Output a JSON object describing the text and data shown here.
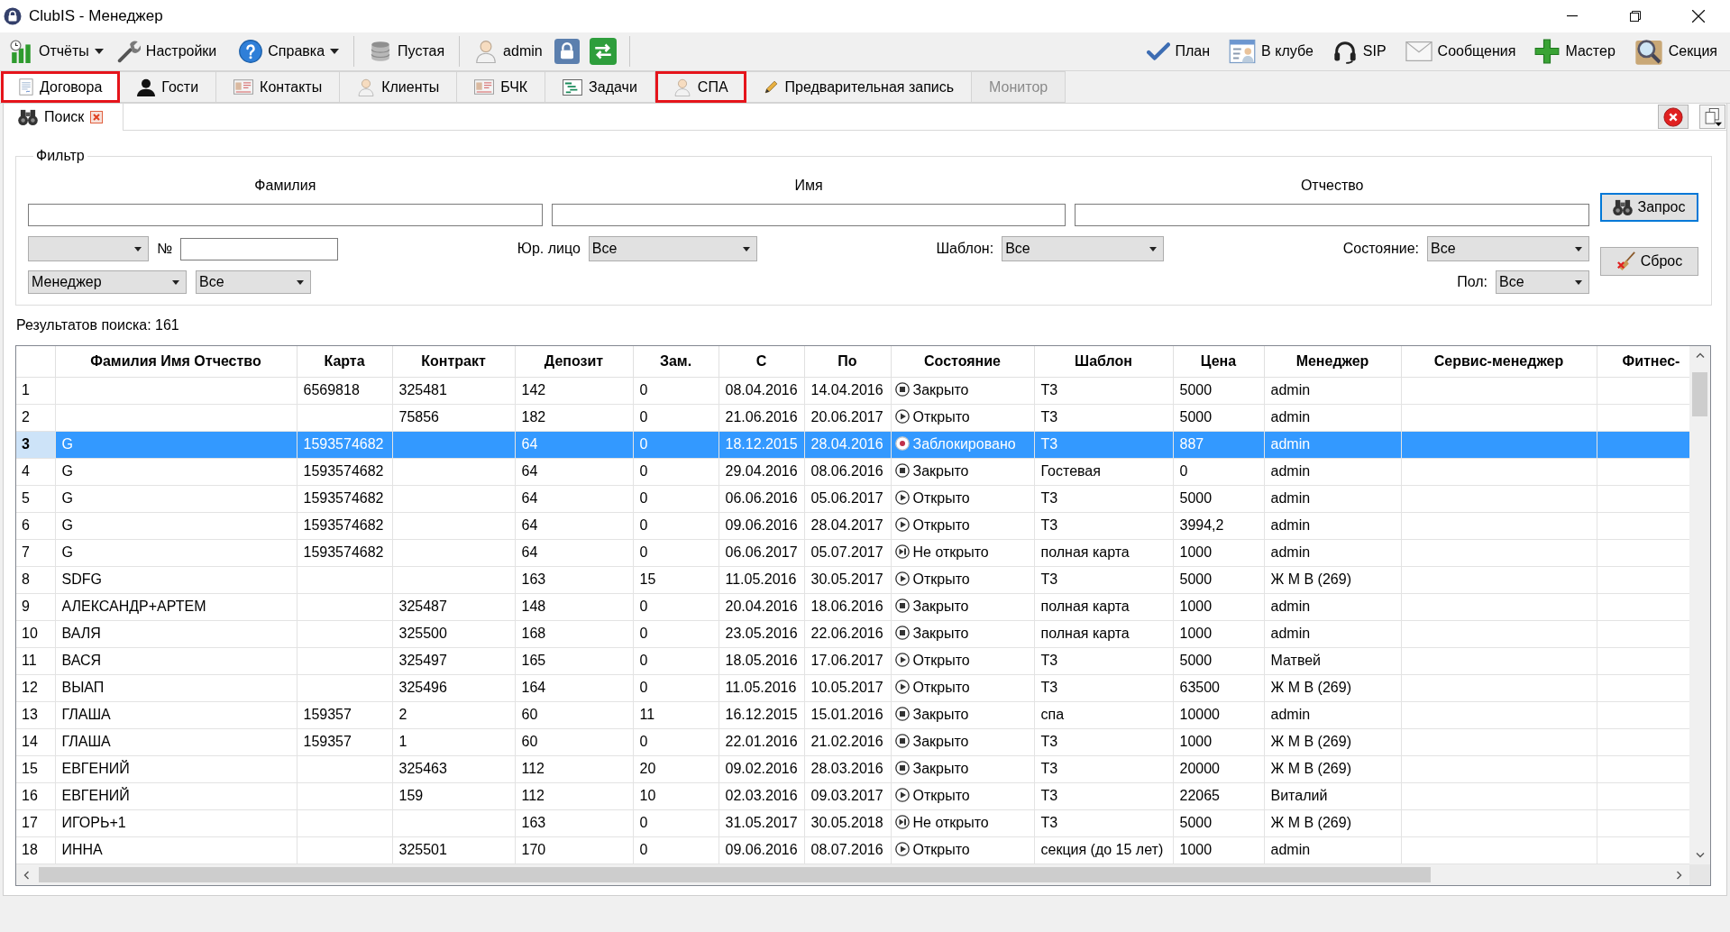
{
  "window": {
    "title": "ClubIS - Менеджер"
  },
  "toolbar": {
    "left_groups": [
      [
        {
          "label": "Отчёты",
          "menu": true
        },
        {
          "label": "Настройки",
          "menu": false
        },
        {
          "label": "Справка",
          "menu": true
        }
      ],
      [
        {
          "label": "Пустая",
          "menu": false
        }
      ],
      [
        {
          "label": "admin",
          "menu": false
        }
      ]
    ],
    "right_items": [
      {
        "label": "План"
      },
      {
        "label": "В клубе"
      },
      {
        "label": "SIP"
      },
      {
        "label": "Сообщения"
      },
      {
        "label": "Мастер"
      },
      {
        "label": "Секция"
      }
    ]
  },
  "tabs": [
    {
      "label": "Договора",
      "selected": true,
      "disabled": false,
      "highlighted": true
    },
    {
      "label": "Гости",
      "selected": false,
      "disabled": false,
      "highlighted": false
    },
    {
      "label": "Контакты",
      "selected": false,
      "disabled": false,
      "highlighted": false
    },
    {
      "label": "Клиенты",
      "selected": false,
      "disabled": false,
      "highlighted": false
    },
    {
      "label": "БЧК",
      "selected": false,
      "disabled": false,
      "highlighted": false
    },
    {
      "label": "Задачи",
      "selected": false,
      "disabled": false,
      "highlighted": false
    },
    {
      "label": "СПА",
      "selected": false,
      "disabled": false,
      "highlighted": true
    },
    {
      "label": "Предварительная запись",
      "selected": false,
      "disabled": false,
      "highlighted": false
    },
    {
      "label": "Монитор",
      "selected": false,
      "disabled": true,
      "highlighted": false
    }
  ],
  "subtabs": [
    {
      "label": "Поиск",
      "selected": true,
      "closable": true
    }
  ],
  "filter": {
    "title": "Фильтр",
    "name_fields": [
      {
        "label": "Фамилия"
      },
      {
        "label": "Имя"
      },
      {
        "label": "Отчество"
      }
    ],
    "number_field": {
      "label": "№"
    },
    "legal_entity": {
      "label": "Юр. лицо",
      "value": "Все"
    },
    "template": {
      "label": "Шаблон:",
      "value": "Все"
    },
    "state": {
      "label": "Состояние:",
      "value": "Все"
    },
    "staff": {
      "role": "Менеджер",
      "value": "Все"
    },
    "gender": {
      "label": "Пол:",
      "value": "Все"
    },
    "buttons": [
      {
        "label": "Запрос",
        "default": true
      },
      {
        "label": "Сброс",
        "default": false
      }
    ]
  },
  "results": "Результатов поиска: 161",
  "table": {
    "columns": [
      "Фамилия Имя Отчество",
      "Карта",
      "Контракт",
      "Депозит",
      "Зам.",
      "С",
      "По",
      "Состояние",
      "Шаблон",
      "Цена",
      "Менеджер",
      "Сервис-менеджер",
      "Фитнес-"
    ],
    "rows": [
      {
        "num": "1",
        "selected": false,
        "card": "6569818",
        "contract": "325481",
        "deposit": "142",
        "freeze": "0",
        "start": "08.04.2016",
        "end": "14.04.2016",
        "state": {
          "text": "Закрыто",
          "kind": "closed"
        },
        "template": "Т3",
        "price": "5000",
        "manager": "admin"
      },
      {
        "num": "2",
        "selected": false,
        "contract": "75856",
        "deposit": "182",
        "freeze": "0",
        "start": "21.06.2016",
        "end": "20.06.2017",
        "state": {
          "text": "Открыто",
          "kind": "open"
        },
        "template": "Т3",
        "price": "5000",
        "manager": "admin"
      },
      {
        "num": "3",
        "selected": true,
        "name": "G",
        "card": "1593574682",
        "deposit": "64",
        "freeze": "0",
        "start": "18.12.2015",
        "end": "28.04.2016",
        "state": {
          "text": "Заблокировано",
          "kind": "blocked"
        },
        "template": "Т3",
        "price": "887",
        "manager": "admin"
      },
      {
        "num": "4",
        "selected": false,
        "name": "G",
        "card": "1593574682",
        "deposit": "64",
        "freeze": "0",
        "start": "29.04.2016",
        "end": "08.06.2016",
        "state": {
          "text": "Закрыто",
          "kind": "closed"
        },
        "template": "Гостевая",
        "price": "0",
        "manager": "admin"
      },
      {
        "num": "5",
        "selected": false,
        "name": "G",
        "card": "1593574682",
        "deposit": "64",
        "freeze": "0",
        "start": "06.06.2016",
        "end": "05.06.2017",
        "state": {
          "text": "Открыто",
          "kind": "open"
        },
        "template": "Т3",
        "price": "5000",
        "manager": "admin"
      },
      {
        "num": "6",
        "selected": false,
        "name": "G",
        "card": "1593574682",
        "deposit": "64",
        "freeze": "0",
        "start": "09.06.2016",
        "end": "28.04.2017",
        "state": {
          "text": "Открыто",
          "kind": "open"
        },
        "template": "Т3",
        "price": "3994,2",
        "manager": "admin"
      },
      {
        "num": "7",
        "selected": false,
        "name": "G",
        "card": "1593574682",
        "deposit": "64",
        "freeze": "0",
        "start": "06.06.2017",
        "end": "05.07.2017",
        "state": {
          "text": "Не открыто",
          "kind": "not_open"
        },
        "template": "полная карта",
        "price": "1000",
        "manager": "admin"
      },
      {
        "num": "8",
        "selected": false,
        "name": "SDFG",
        "deposit": "163",
        "freeze": "15",
        "start": "11.05.2016",
        "end": "30.05.2017",
        "state": {
          "text": "Открыто",
          "kind": "open"
        },
        "template": "Т3",
        "price": "5000",
        "manager": "Ж М В (269)"
      },
      {
        "num": "9",
        "selected": false,
        "name": "АЛЕКСАНДР+АРТЕМ",
        "contract": "325487",
        "deposit": "148",
        "freeze": "0",
        "start": "20.04.2016",
        "end": "18.06.2016",
        "state": {
          "text": "Закрыто",
          "kind": "closed"
        },
        "template": "полная карта",
        "price": "1000",
        "manager": "admin"
      },
      {
        "num": "10",
        "selected": false,
        "name": "ВАЛЯ",
        "contract": "325500",
        "deposit": "168",
        "freeze": "0",
        "start": "23.05.2016",
        "end": "22.06.2016",
        "state": {
          "text": "Закрыто",
          "kind": "closed"
        },
        "template": "полная карта",
        "price": "1000",
        "manager": "admin"
      },
      {
        "num": "11",
        "selected": false,
        "name": "ВАСЯ",
        "contract": "325497",
        "deposit": "165",
        "freeze": "0",
        "start": "18.05.2016",
        "end": "17.06.2017",
        "state": {
          "text": "Открыто",
          "kind": "open"
        },
        "template": "Т3",
        "price": "5000",
        "manager": "Матвей"
      },
      {
        "num": "12",
        "selected": false,
        "name": "ВЫАП",
        "contract": "325496",
        "deposit": "164",
        "freeze": "0",
        "start": "11.05.2016",
        "end": "10.05.2017",
        "state": {
          "text": "Открыто",
          "kind": "open"
        },
        "template": "Т3",
        "price": "63500",
        "manager": "Ж М В (269)"
      },
      {
        "num": "13",
        "selected": false,
        "name": "ГЛАША",
        "card": "159357",
        "contract": "2",
        "deposit": "60",
        "freeze": "11",
        "start": "16.12.2015",
        "end": "15.01.2016",
        "state": {
          "text": "Закрыто",
          "kind": "closed"
        },
        "template": "спа",
        "price": "10000",
        "manager": "admin"
      },
      {
        "num": "14",
        "selected": false,
        "name": "ГЛАША",
        "card": "159357",
        "contract": "1",
        "deposit": "60",
        "freeze": "0",
        "start": "22.01.2016",
        "end": "21.02.2016",
        "state": {
          "text": "Закрыто",
          "kind": "closed"
        },
        "template": "Т3",
        "price": "1000",
        "manager": "Ж М В (269)"
      },
      {
        "num": "15",
        "selected": false,
        "name": "ЕВГЕНИЙ",
        "contract": "325463",
        "deposit": "112",
        "freeze": "20",
        "start": "09.02.2016",
        "end": "28.03.2016",
        "state": {
          "text": "Закрыто",
          "kind": "closed"
        },
        "template": "Т3",
        "price": "20000",
        "manager": "Ж М В (269)"
      },
      {
        "num": "16",
        "selected": false,
        "name": "ЕВГЕНИЙ",
        "contract": "159",
        "deposit": "112",
        "freeze": "10",
        "start": "02.03.2016",
        "end": "09.03.2017",
        "state": {
          "text": "Открыто",
          "kind": "open"
        },
        "template": "Т3",
        "price": "22065",
        "manager": "Виталий"
      },
      {
        "num": "17",
        "selected": false,
        "name": "ИГОРЬ+1",
        "deposit": "163",
        "freeze": "0",
        "start": "31.05.2017",
        "end": "30.05.2018",
        "state": {
          "text": "Не открыто",
          "kind": "not_open"
        },
        "template": "Т3",
        "price": "5000",
        "manager": "Ж М В (269)"
      },
      {
        "num": "18",
        "selected": false,
        "name": "ИННА",
        "contract": "325501",
        "deposit": "170",
        "freeze": "0",
        "start": "09.06.2016",
        "end": "08.07.2016",
        "state": {
          "text": "Открыто",
          "kind": "open"
        },
        "template": "секция (до 15 лет)",
        "price": "1000",
        "manager": "admin"
      }
    ]
  }
}
